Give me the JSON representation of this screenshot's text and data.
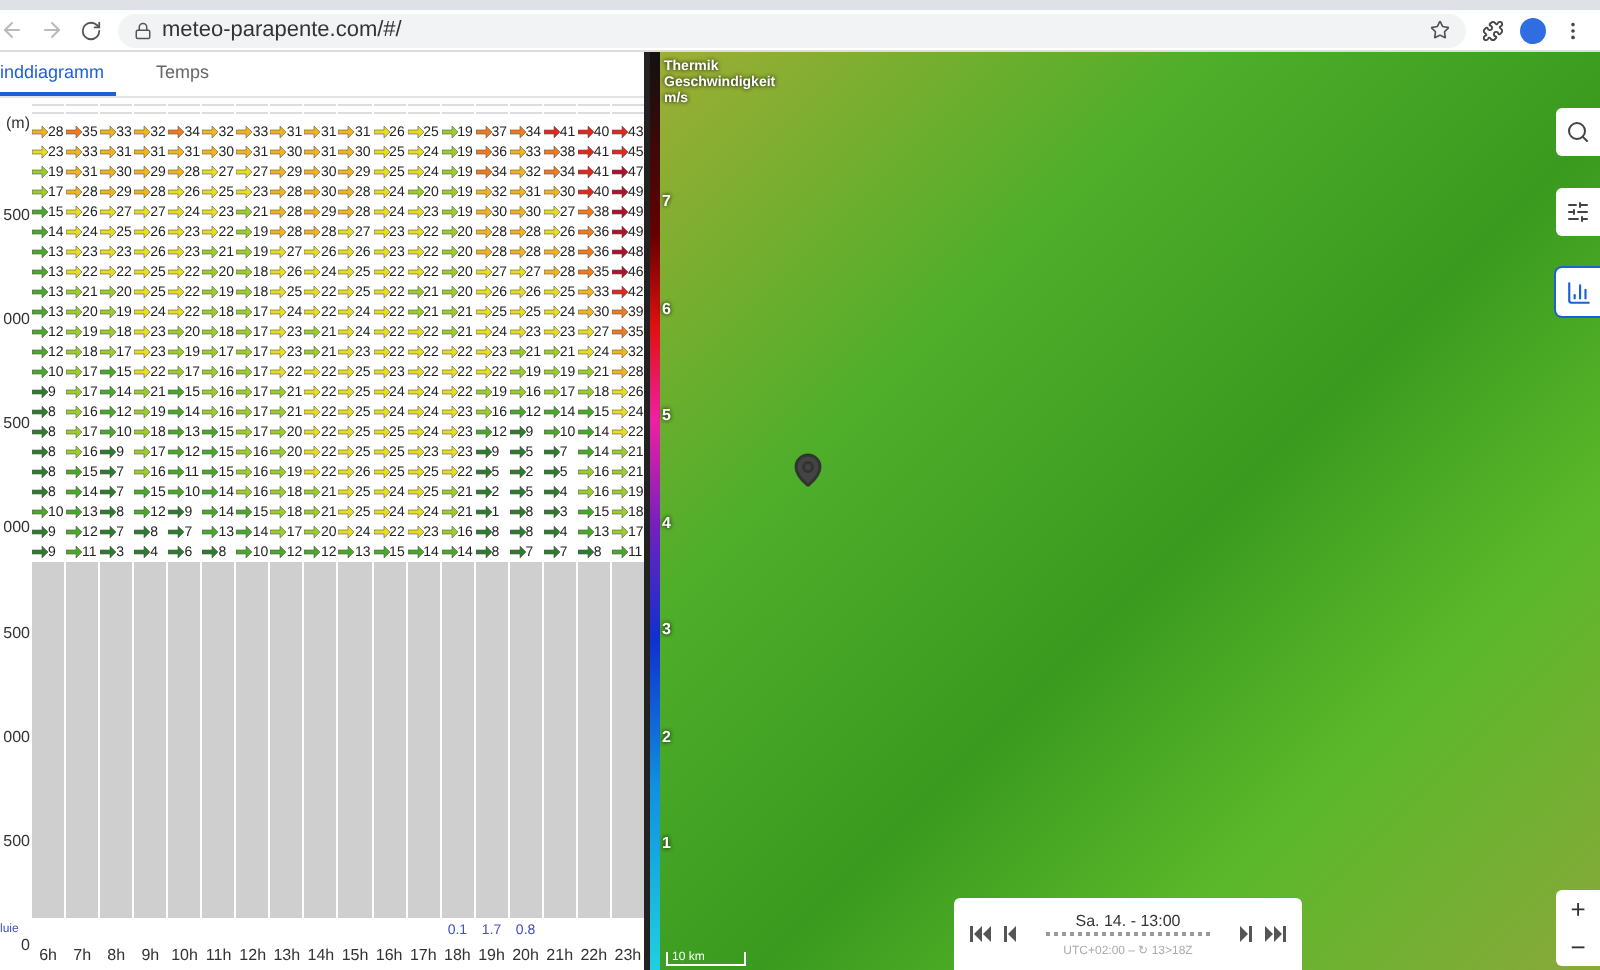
{
  "browser": {
    "url": "meteo-parapente.com/#/"
  },
  "tabs": [
    {
      "label": "inddiagramm",
      "selected": true
    },
    {
      "label": "Temps",
      "selected": false
    }
  ],
  "wind_diagram": {
    "axis_labels": [
      "(m)",
      "500",
      "000",
      "500",
      "000",
      "500",
      "000",
      "500",
      "0"
    ],
    "rows": [
      [
        "28",
        "35",
        "33",
        "32",
        "34",
        "32",
        "33",
        "31",
        "31",
        "31",
        "26",
        "25",
        "19",
        "37",
        "34",
        "41",
        "40",
        "43"
      ],
      [
        "23",
        "33",
        "31",
        "31",
        "31",
        "30",
        "31",
        "30",
        "31",
        "30",
        "25",
        "24",
        "19",
        "36",
        "33",
        "38",
        "41",
        "45"
      ],
      [
        "19",
        "31",
        "30",
        "29",
        "28",
        "27",
        "27",
        "29",
        "30",
        "29",
        "25",
        "24",
        "19",
        "34",
        "32",
        "34",
        "41",
        "47"
      ],
      [
        "17",
        "28",
        "29",
        "28",
        "26",
        "25",
        "23",
        "28",
        "30",
        "28",
        "24",
        "20",
        "19",
        "32",
        "31",
        "30",
        "40",
        "49"
      ],
      [
        "15",
        "26",
        "27",
        "27",
        "24",
        "23",
        "21",
        "28",
        "29",
        "28",
        "24",
        "23",
        "19",
        "30",
        "30",
        "27",
        "38",
        "49"
      ],
      [
        "14",
        "24",
        "25",
        "26",
        "23",
        "22",
        "19",
        "28",
        "28",
        "27",
        "23",
        "22",
        "20",
        "28",
        "28",
        "26",
        "36",
        "49"
      ],
      [
        "13",
        "23",
        "23",
        "26",
        "23",
        "21",
        "19",
        "27",
        "26",
        "26",
        "23",
        "22",
        "20",
        "28",
        "28",
        "28",
        "36",
        "48"
      ],
      [
        "13",
        "22",
        "22",
        "25",
        "22",
        "20",
        "18",
        "26",
        "24",
        "25",
        "22",
        "22",
        "20",
        "27",
        "27",
        "28",
        "35",
        "46"
      ],
      [
        "13",
        "21",
        "20",
        "25",
        "22",
        "19",
        "18",
        "25",
        "22",
        "25",
        "22",
        "21",
        "20",
        "26",
        "26",
        "25",
        "33",
        "42"
      ],
      [
        "13",
        "20",
        "19",
        "24",
        "22",
        "18",
        "17",
        "24",
        "22",
        "24",
        "22",
        "21",
        "21",
        "25",
        "25",
        "24",
        "30",
        "39"
      ],
      [
        "12",
        "19",
        "18",
        "23",
        "20",
        "18",
        "17",
        "23",
        "21",
        "24",
        "22",
        "22",
        "21",
        "24",
        "23",
        "23",
        "27",
        "35"
      ],
      [
        "12",
        "18",
        "17",
        "23",
        "19",
        "17",
        "17",
        "23",
        "21",
        "23",
        "22",
        "22",
        "22",
        "23",
        "21",
        "21",
        "24",
        "32"
      ],
      [
        "10",
        "17",
        "15",
        "22",
        "17",
        "16",
        "17",
        "22",
        "22",
        "25",
        "23",
        "22",
        "22",
        "22",
        "19",
        "19",
        "21",
        "28"
      ],
      [
        "9",
        "17",
        "14",
        "21",
        "15",
        "16",
        "17",
        "21",
        "22",
        "25",
        "24",
        "24",
        "22",
        "19",
        "16",
        "17",
        "18",
        "26"
      ],
      [
        "8",
        "16",
        "12",
        "19",
        "14",
        "16",
        "17",
        "21",
        "22",
        "25",
        "24",
        "24",
        "23",
        "16",
        "12",
        "14",
        "15",
        "24"
      ],
      [
        "8",
        "17",
        "10",
        "18",
        "13",
        "15",
        "17",
        "20",
        "22",
        "25",
        "25",
        "24",
        "23",
        "12",
        "9",
        "10",
        "14",
        "22"
      ],
      [
        "8",
        "16",
        "9",
        "17",
        "12",
        "15",
        "16",
        "20",
        "22",
        "25",
        "25",
        "23",
        "23",
        "9",
        "5",
        "7",
        "14",
        "21"
      ],
      [
        "8",
        "15",
        "7",
        "16",
        "11",
        "15",
        "16",
        "19",
        "22",
        "26",
        "25",
        "25",
        "22",
        "5",
        "2",
        "5",
        "16",
        "21"
      ],
      [
        "8",
        "14",
        "7",
        "15",
        "10",
        "14",
        "16",
        "18",
        "21",
        "25",
        "24",
        "25",
        "21",
        "2",
        "5",
        "4",
        "16",
        "19"
      ],
      [
        "10",
        "13",
        "8",
        "12",
        "9",
        "14",
        "15",
        "18",
        "21",
        "25",
        "24",
        "24",
        "21",
        "1",
        "8",
        "3",
        "15",
        "18"
      ],
      [
        "9",
        "12",
        "7",
        "8",
        "7",
        "13",
        "14",
        "17",
        "20",
        "24",
        "22",
        "23",
        "16",
        "8",
        "8",
        "4",
        "13",
        "17"
      ],
      [
        "9",
        "11",
        "3",
        "4",
        "6",
        "8",
        "10",
        "12",
        "12",
        "13",
        "15",
        "14",
        "14",
        "8",
        "7",
        "7",
        "8",
        "11"
      ]
    ],
    "rain_label": "luie",
    "hours": [
      {
        "label": "6h"
      },
      {
        "label": "7h"
      },
      {
        "label": "8h"
      },
      {
        "label": "9h"
      },
      {
        "label": "10h"
      },
      {
        "label": "11h"
      },
      {
        "label": "12h"
      },
      {
        "label": "13h"
      },
      {
        "label": "14h"
      },
      {
        "label": "15h"
      },
      {
        "label": "16h"
      },
      {
        "label": "17h"
      },
      {
        "label": "18h",
        "rain": "0.1"
      },
      {
        "label": "19h",
        "rain": "1.7"
      },
      {
        "label": "20h",
        "rain": "0.8"
      },
      {
        "label": "21h"
      },
      {
        "label": "22h"
      },
      {
        "label": "23h"
      }
    ]
  },
  "map": {
    "legend": {
      "lines": [
        "Thermik",
        "Geschwindigkeit",
        "m/s"
      ],
      "scale": [
        "7",
        "6",
        "5",
        "4",
        "3",
        "2",
        "1"
      ]
    },
    "tools": [
      {
        "kind": "search",
        "selected": false
      },
      {
        "kind": "settings",
        "selected": false
      },
      {
        "kind": "chart",
        "selected": true
      }
    ],
    "time": {
      "label": "Sa. 14. - 13:00",
      "zone": "UTC+02:00 – ↻ 13>18Z"
    },
    "scale": "10 km",
    "zoom": [
      "+",
      "−"
    ]
  }
}
